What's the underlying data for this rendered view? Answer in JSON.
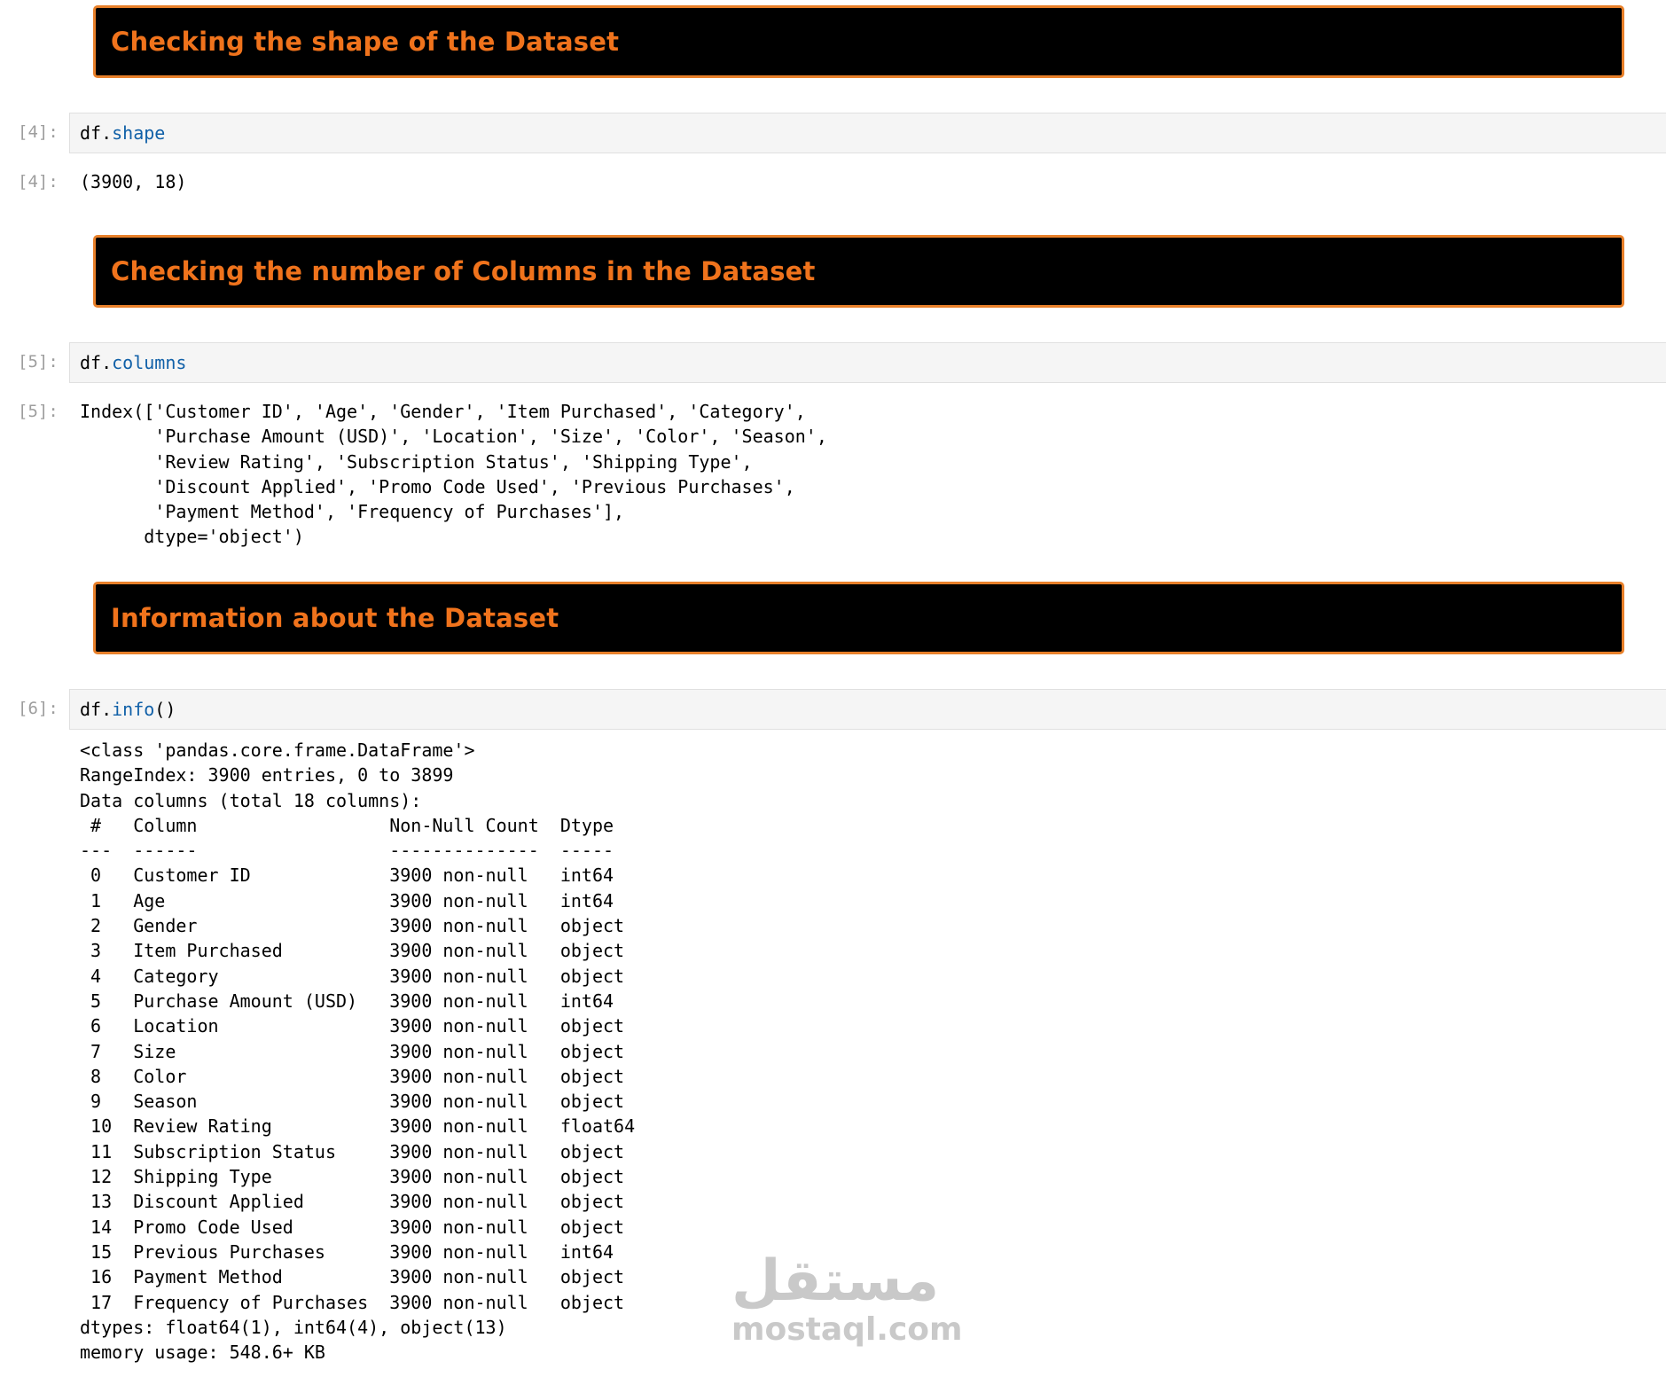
{
  "cells": {
    "shape_heading": "Checking the shape of the Dataset",
    "columns_heading": "Checking the number of Columns in the Dataset",
    "info_heading": "Information about the Dataset",
    "cell4": {
      "prompt_in": "[4]:",
      "prompt_out": "[4]:",
      "code_var": "df.",
      "code_attr": "shape",
      "output": "(3900, 18)"
    },
    "cell5": {
      "prompt_in": "[5]:",
      "prompt_out": "[5]:",
      "code_var": "df.",
      "code_attr": "columns",
      "output": "Index(['Customer ID', 'Age', 'Gender', 'Item Purchased', 'Category',\n       'Purchase Amount (USD)', 'Location', 'Size', 'Color', 'Season',\n       'Review Rating', 'Subscription Status', 'Shipping Type',\n       'Discount Applied', 'Promo Code Used', 'Previous Purchases',\n       'Payment Method', 'Frequency of Purchases'],\n      dtype='object')"
    },
    "cell6": {
      "prompt_in": "[6]:",
      "code_var": "df.",
      "code_attr": "info",
      "code_suffix": "()",
      "output": "<class 'pandas.core.frame.DataFrame'>\nRangeIndex: 3900 entries, 0 to 3899\nData columns (total 18 columns):\n #   Column                  Non-Null Count  Dtype  \n---  ------                  --------------  -----  \n 0   Customer ID             3900 non-null   int64  \n 1   Age                     3900 non-null   int64  \n 2   Gender                  3900 non-null   object \n 3   Item Purchased          3900 non-null   object \n 4   Category                3900 non-null   object \n 5   Purchase Amount (USD)   3900 non-null   int64  \n 6   Location                3900 non-null   object \n 7   Size                    3900 non-null   object \n 8   Color                   3900 non-null   object \n 9   Season                  3900 non-null   object \n 10  Review Rating           3900 non-null   float64\n 11  Subscription Status     3900 non-null   object \n 12  Shipping Type           3900 non-null   object \n 13  Discount Applied        3900 non-null   object \n 14  Promo Code Used         3900 non-null   object \n 15  Previous Purchases      3900 non-null   int64  \n 16  Payment Method          3900 non-null   object \n 17  Frequency of Purchases  3900 non-null   object \ndtypes: float64(1), int64(4), object(13)\nmemory usage: 548.6+ KB"
    }
  },
  "watermark": {
    "arabic": "مستقل",
    "latin": "mostaql.com"
  },
  "colors": {
    "banner_bg": "#000000",
    "banner_border": "#e8802a",
    "banner_text": "#f0731c",
    "code_attr": "#1060a8",
    "prompt": "#9e9e9e"
  }
}
